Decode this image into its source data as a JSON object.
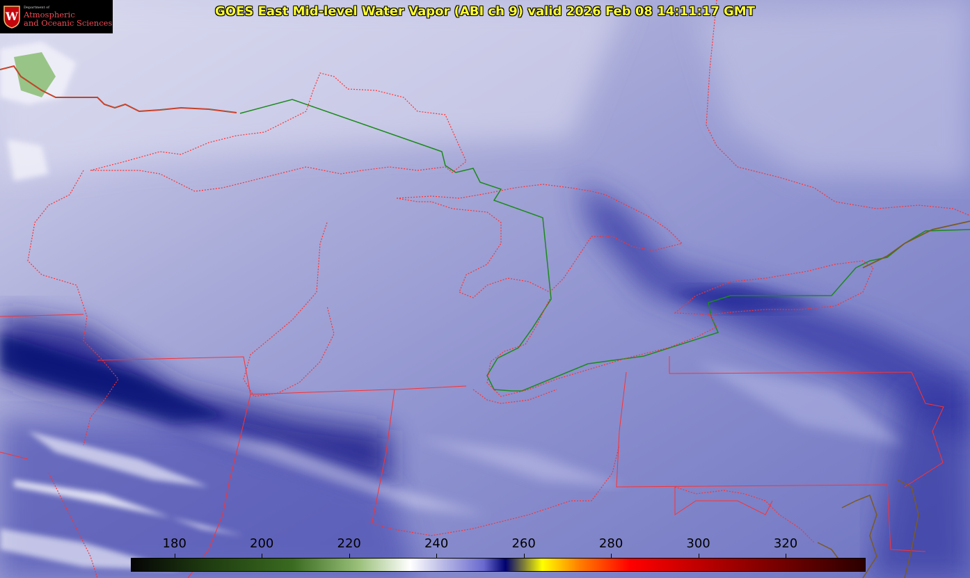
{
  "title": "GOES East Mid-level Water Vapor (ABI ch 9)  valid 2026 Feb 08 14:11:17 GMT",
  "logo": {
    "dept_line": "Department of",
    "line1": "Atmospheric",
    "line2": "and Oceanic Sciences",
    "crest_letter": "W",
    "color": "#c5050c"
  },
  "colorbar": {
    "units_min": 170,
    "units_max": 338,
    "ticks": [
      "180",
      "200",
      "220",
      "240",
      "260",
      "280",
      "300",
      "320"
    ]
  },
  "colors": {
    "state_borders": "#ff3030",
    "international_border": "#1a8a1a",
    "coastline": "#7a5a20",
    "title_text": "#ffff33"
  }
}
